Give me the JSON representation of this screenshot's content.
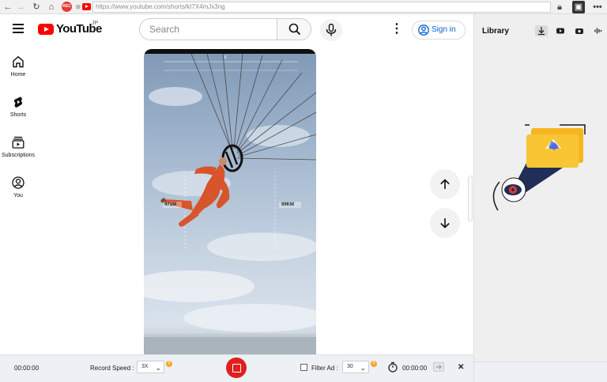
{
  "browser": {
    "url": "https://www.youtube.com/shorts/kI7X4mJx3ng",
    "rec_badge": "REC",
    "more": "•••"
  },
  "header": {
    "logo_text": "YouTube",
    "logo_country": "JP",
    "search_placeholder": "Search",
    "signin_label": "Sign in"
  },
  "sidebar": {
    "items": [
      {
        "label": "Home",
        "icon": "home-icon"
      },
      {
        "label": "Shorts",
        "icon": "shorts-icon"
      },
      {
        "label": "Subscriptions",
        "icon": "subscriptions-icon"
      },
      {
        "label": "You",
        "icon": "account-icon"
      }
    ]
  },
  "video": {
    "overlay_left": "471M",
    "overlay_right": "99KM",
    "overlay_top": "6"
  },
  "library": {
    "title": "Library",
    "tabs": [
      "download-icon",
      "video-icon",
      "camera-icon",
      "audio-icon"
    ]
  },
  "bottombar": {
    "elapsed": "00:00:00",
    "record_speed_label": "Record Speed :",
    "record_speed_value": "3X",
    "filter_ad_label": "Filter Ad :",
    "filter_ad_value": "30",
    "timer_value": "00:00:00",
    "help": "?",
    "close": "✕"
  },
  "colors": {
    "youtube_red": "#ff0000",
    "record_red": "#e0201e",
    "link_blue": "#065fd4"
  }
}
